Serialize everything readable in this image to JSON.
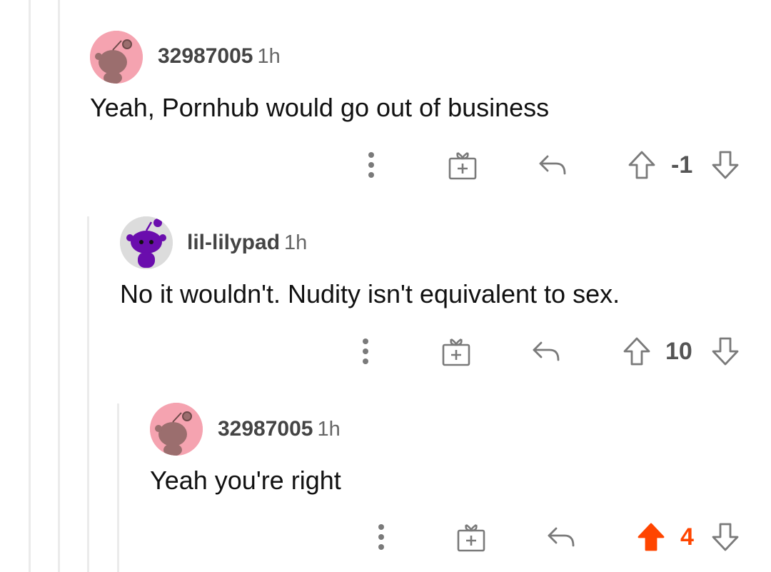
{
  "colors": {
    "avatar_pink_bg": "#f5a3b0",
    "avatar_grey_bg": "#dcdcdc",
    "snoo_purple": "#6a0dad",
    "upvote_active": "#ff4500",
    "icon_grey": "#7a7a7a"
  },
  "comments": [
    {
      "author": "32987005",
      "time": "1h",
      "avatar_icon": "snoo-avatar-icon",
      "body": "Yeah, Pornhub would go out of business",
      "score": "-1",
      "upvoted": false
    },
    {
      "author": "lil-lilypad",
      "time": "1h",
      "avatar_icon": "snoo-avatar-icon",
      "body": "No it wouldn't. Nudity isn't equivalent to sex.",
      "score": "10",
      "upvoted": false
    },
    {
      "author": "32987005",
      "time": "1h",
      "avatar_icon": "snoo-avatar-icon",
      "body": "Yeah you're right",
      "score": "4",
      "upvoted": true
    }
  ],
  "icons": {
    "more": "more-options-icon",
    "award": "award-gift-icon",
    "reply": "reply-arrow-icon",
    "upvote": "upvote-arrow-icon",
    "downvote": "downvote-arrow-icon"
  }
}
